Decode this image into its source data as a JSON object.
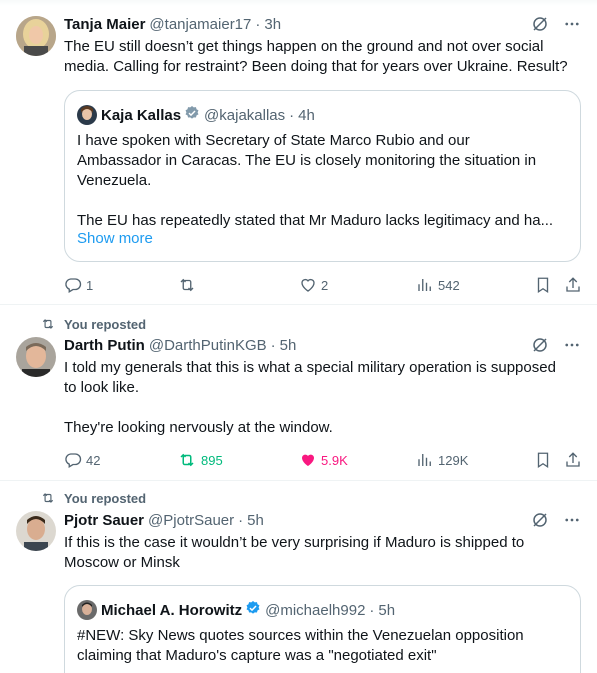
{
  "tweets": [
    {
      "name": "Tanja Maier",
      "handle": "@tanjamaier17",
      "time": "3h",
      "text": "The EU still doesn’t get things happen on the ground and not over social\nmedia. Calling for restraint? Been doing that for years over Ukraine. Result?",
      "quote": {
        "name": "Kaja Kallas",
        "handle": "@kajakallas",
        "time": "4h",
        "verified": true,
        "text": "I have spoken with Secretary of State Marco Rubio and our\nAmbassador in Caracas. The EU is closely monitoring the situation in\nVenezuela.\n\nThe EU has repeatedly stated that Mr Maduro lacks legitimacy and ha...",
        "show_more": "Show more"
      },
      "actions": {
        "replies": "1",
        "reposts": "",
        "likes": "2",
        "views": "542"
      }
    },
    {
      "reposted_label": "You reposted",
      "name": "Darth Putin",
      "handle": "@DarthPutinKGB",
      "time": "5h",
      "text": "I told my generals that this is what a special military operation is supposed\nto look like.\n\nThey're looking nervously at the window.",
      "actions": {
        "replies": "42",
        "reposts": "895",
        "likes": "5.9K",
        "views": "129K"
      },
      "reposted": true,
      "liked": true
    },
    {
      "reposted_label": "You reposted",
      "name": "Pjotr Sauer",
      "handle": "@PjotrSauer",
      "time": "5h",
      "text": "If this is the case it wouldn’t be very surprising if Maduro is shipped to\nMoscow or Minsk",
      "quote": {
        "name": "Michael A. Horowitz",
        "handle": "@michaelh992",
        "time": "5h",
        "verified": true,
        "text": "#NEW: Sky News quotes sources within the Venezuelan opposition\nclaiming that Maduro's capture was a \"negotiated exit\""
      }
    }
  ],
  "colors": {
    "accent": "#1d9bf0",
    "repost_green": "#00ba7c",
    "like_pink": "#f91880",
    "muted": "#536471"
  },
  "icons": [
    "grok-icon",
    "more-icon",
    "reply-icon",
    "repost-icon",
    "like-icon",
    "views-icon",
    "bookmark-icon",
    "share-icon",
    "verified-icon"
  ]
}
